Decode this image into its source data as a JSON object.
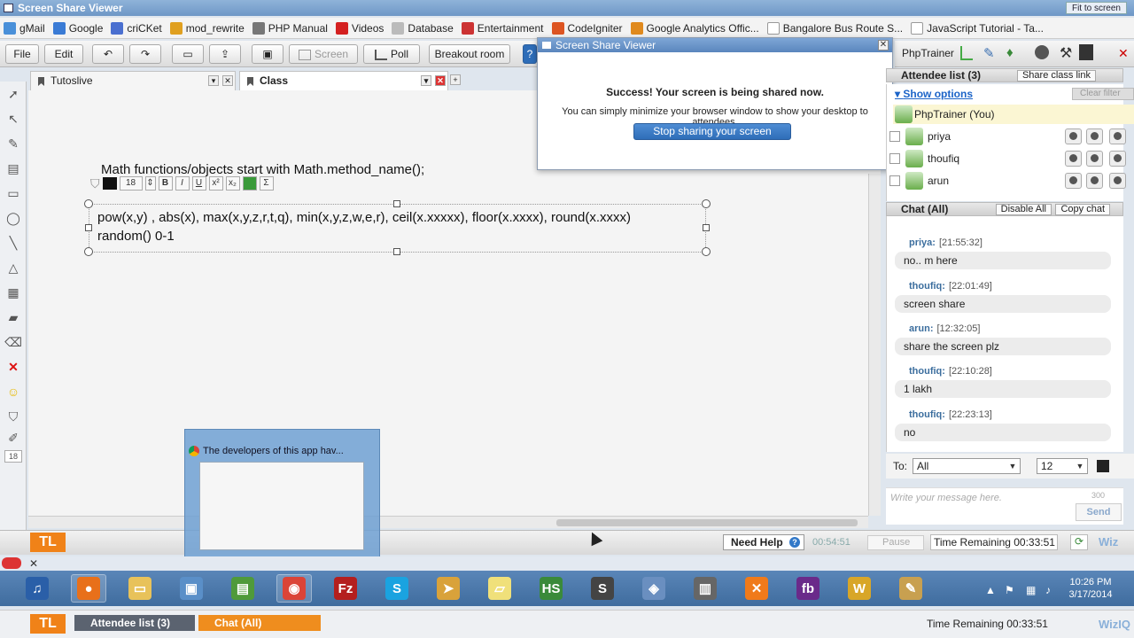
{
  "window": {
    "title": "Screen Share Viewer",
    "fit_label": "Fit to screen"
  },
  "bookmarks": [
    {
      "label": "gMail",
      "color": "#4a90d9"
    },
    {
      "label": "Google",
      "color": "#3a7bd5"
    },
    {
      "label": "criCKet",
      "color": "#4a6fd0"
    },
    {
      "label": "mod_rewrite",
      "color": "#e0a020"
    },
    {
      "label": "PHP Manual",
      "color": "#777777"
    },
    {
      "label": "Videos",
      "color": "#d42020"
    },
    {
      "label": "Database",
      "color": "#bbbbbb"
    },
    {
      "label": "Entertainment",
      "color": "#cc3333"
    },
    {
      "label": "CodeIgniter",
      "color": "#dd5522"
    },
    {
      "label": "Google Analytics Offic...",
      "color": "#e08a1e"
    },
    {
      "label": "Bangalore Bus Route S...",
      "color": "#ffffff"
    },
    {
      "label": "JavaScript Tutorial - Ta...",
      "color": "#ffffff"
    }
  ],
  "toolbar": {
    "file": "File",
    "edit": "Edit",
    "screen": "Screen",
    "poll": "Poll",
    "breakout": "Breakout room",
    "user": "PhpTrainer"
  },
  "tabs": [
    {
      "label": "Tutoslive"
    },
    {
      "label": "Class"
    }
  ],
  "board": {
    "heading": "Math functions/objects start with Math.method_name();",
    "font_size": "18",
    "line1": "pow(x,y) , abs(x), max(x,y,z,r,t,q), min(x,y,z,w,e,r), ceil(x.xxxxx), floor(x.xxxx), round(x.xxxx)",
    "line2": "random() 0-1"
  },
  "popup": {
    "title": "Screen Share Viewer",
    "success": "Success! Your screen is being shared now.",
    "hint": "You can simply minimize your browser window to show your desktop to attendees.",
    "stop_button": "Stop sharing your screen"
  },
  "attendees": {
    "header": "Attendee list (3)",
    "share_link": "Share class link",
    "show_options": "Show options",
    "clear_filter": "Clear filter",
    "me": "PhpTrainer (You)",
    "list": [
      {
        "name": "priya"
      },
      {
        "name": "thoufiq"
      },
      {
        "name": "arun"
      }
    ]
  },
  "chat": {
    "header": "Chat (All)",
    "disable_all": "Disable All",
    "copy_chat": "Copy chat",
    "messages": [
      {
        "who": "priya:",
        "time": "[21:55:32]",
        "text": "no.. m here"
      },
      {
        "who": "thoufiq:",
        "time": "[22:01:49]",
        "text": "screen share"
      },
      {
        "who": "arun:",
        "time": "[12:32:05]",
        "text": "share the screen plz"
      },
      {
        "who": "thoufiq:",
        "time": "[22:10:28]",
        "text": "1 lakh"
      },
      {
        "who": "thoufiq:",
        "time": "[22:23:13]",
        "text": "no"
      }
    ],
    "to_label": "To:",
    "to_value": "All",
    "size_value": "12",
    "placeholder": "Write your message here.",
    "char_limit": "300",
    "send": "Send"
  },
  "status": {
    "logo": "TL",
    "need_help": "Need Help",
    "elapsed": "00:54:51",
    "pause": "Pause",
    "time_remaining": "Time Remaining  00:33:51",
    "brand": "Wiz"
  },
  "preview": {
    "title": "The developers of this app hav..."
  },
  "lower": {
    "attendee_tab": "Attendee list (3)",
    "chat_tab": "Chat (All)",
    "time_remaining": "Time Remaining  00:33:51",
    "brand": "WizIQ"
  },
  "clock": {
    "time": "10:26 PM",
    "date": "3/17/2014"
  },
  "taskbar_apps": [
    {
      "name": "itunes-icon",
      "glyph": "♫",
      "color": "#2a5fa8"
    },
    {
      "name": "firefox-icon",
      "glyph": "●",
      "color": "#e8701a"
    },
    {
      "name": "explorer-folder-icon",
      "glyph": "▭",
      "color": "#e8c25a"
    },
    {
      "name": "network-icon",
      "glyph": "▣",
      "color": "#5a8fc8"
    },
    {
      "name": "chart-app-icon",
      "glyph": "▤",
      "color": "#4f9a3a"
    },
    {
      "name": "chrome-icon",
      "glyph": "◉",
      "color": "#db4437"
    },
    {
      "name": "filezilla-icon",
      "glyph": "Fz",
      "color": "#b41f1f"
    },
    {
      "name": "skype-icon",
      "glyph": "S",
      "color": "#1aa3e0"
    },
    {
      "name": "sendto-icon",
      "glyph": "➤",
      "color": "#d9a23a"
    },
    {
      "name": "sticky-notes-icon",
      "glyph": "▱",
      "color": "#f0e07a"
    },
    {
      "name": "hs-icon",
      "glyph": "HS",
      "color": "#3a8a3a"
    },
    {
      "name": "sublime-icon",
      "glyph": "S",
      "color": "#444444"
    },
    {
      "name": "virtualbox-icon",
      "glyph": "◈",
      "color": "#6a8fc0"
    },
    {
      "name": "film-icon",
      "glyph": "▥",
      "color": "#666666"
    },
    {
      "name": "xampp-icon",
      "glyph": "✕",
      "color": "#f07a1a"
    },
    {
      "name": "flash-builder-icon",
      "glyph": "fb",
      "color": "#6a2a8a"
    },
    {
      "name": "word-icon",
      "glyph": "W",
      "color": "#d8a628"
    },
    {
      "name": "paint-icon",
      "glyph": "✎",
      "color": "#c8a050"
    }
  ]
}
